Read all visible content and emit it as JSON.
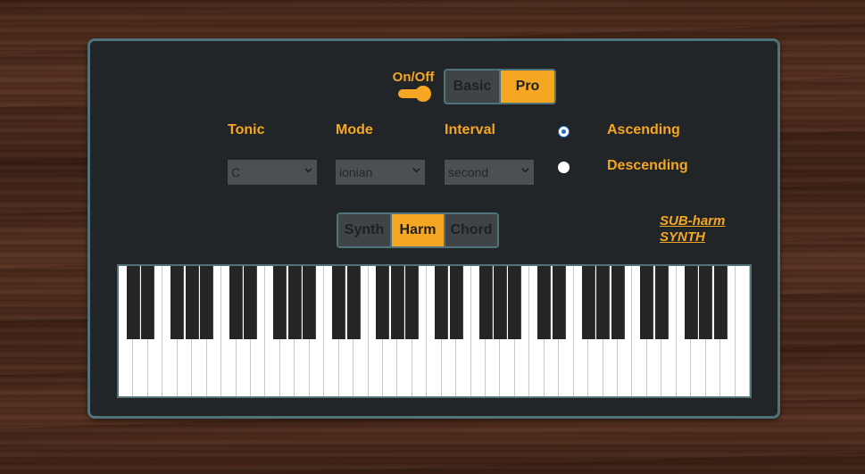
{
  "power": {
    "label": "On/Off",
    "on": true
  },
  "mode_toggle": {
    "options": [
      "Basic",
      "Pro"
    ],
    "active": "Pro"
  },
  "fields": {
    "tonic": {
      "label": "Tonic",
      "value": "C"
    },
    "mode": {
      "label": "Mode",
      "value": "ionian"
    },
    "interval": {
      "label": "Interval",
      "value": "second"
    }
  },
  "direction": {
    "options": [
      "Ascending",
      "Descending"
    ],
    "selected": "Ascending"
  },
  "view_toggle": {
    "options": [
      "Synth",
      "Harm",
      "Chord"
    ],
    "active": "Harm"
  },
  "link": {
    "line1": "SUB-harm",
    "line2": "SYNTH"
  },
  "keyboard": {
    "white_keys": 43
  },
  "colors": {
    "accent": "#f5a623",
    "panel": "#222527",
    "border": "#4f7379"
  }
}
